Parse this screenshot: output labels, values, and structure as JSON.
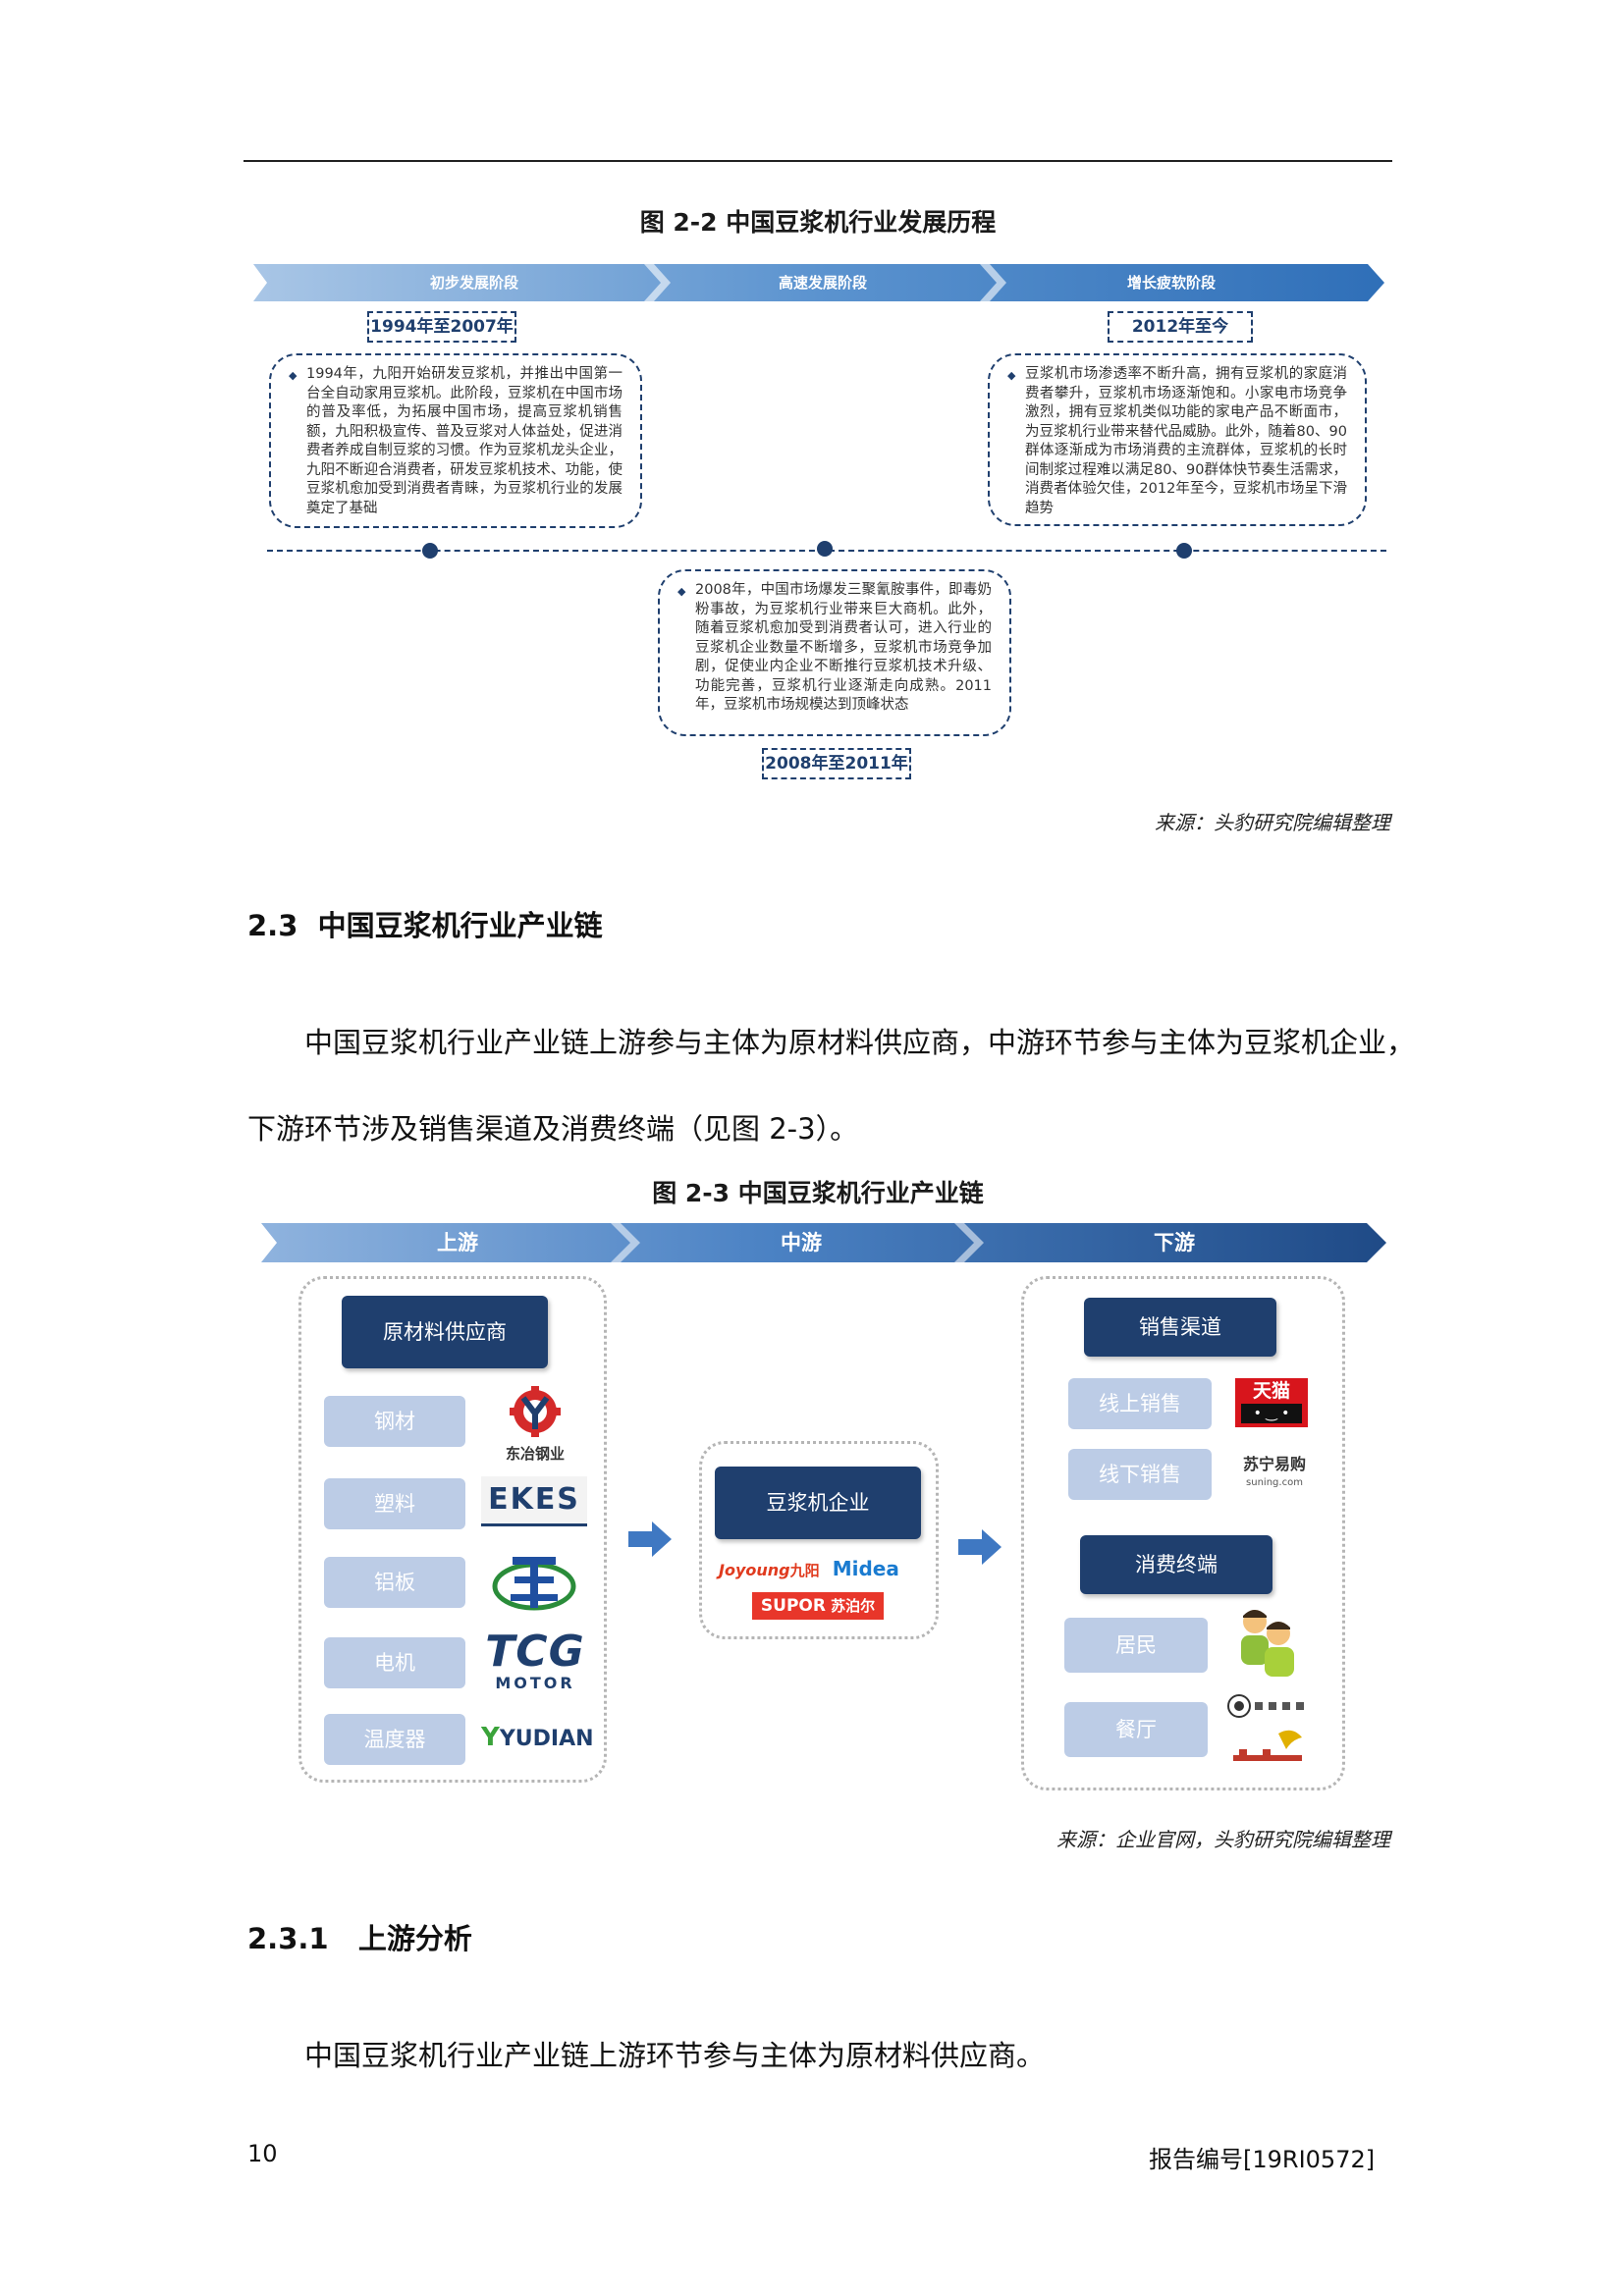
{
  "figure22": {
    "title": "图 2-2 中国豆浆机行业发展历程",
    "phases": [
      "初步发展阶段",
      "高速发展阶段",
      "增长疲软阶段"
    ],
    "periods": [
      "1994年至2007年",
      "2008年至2011年",
      "2012年至今"
    ],
    "texts": [
      "1994年，九阳开始研发豆浆机，并推出中国第一台全自动家用豆浆机。此阶段，豆浆机在中国市场的普及率低，为拓展中国市场，提高豆浆机销售额，九阳积极宣传、普及豆浆对人体益处，促进消费者养成自制豆浆的习惯。作为豆浆机龙头企业，九阳不断迎合消费者，研发豆浆机技术、功能，使豆浆机愈加受到消费者青睐，为豆浆机行业的发展奠定了基础",
      "2008年，中国市场爆发三聚氰胺事件，即毒奶粉事故，为豆浆机行业带来巨大商机。此外，随着豆浆机愈加受到消费者认可，进入行业的豆浆机企业数量不断增多，豆浆机市场竞争加剧，促使业内企业不断推行豆浆机技术升级、功能完善，豆浆机行业逐渐走向成熟。2011年，豆浆机市场规模达到顶峰状态",
      "豆浆机市场渗透率不断升高，拥有豆浆机的家庭消费者攀升，豆浆机市场逐渐饱和。小家电市场竞争激烈，拥有豆浆机类似功能的家电产品不断面市，为豆浆机行业带来替代品威胁。此外，随着80、90群体逐渐成为市场消费的主流群体，豆浆机的长时间制浆过程难以满足80、90群体快节奏生活需求，消费者体验欠佳，2012年至今，豆浆机市场呈下滑趋势"
    ],
    "source": "来源：头豹研究院编辑整理"
  },
  "section23": {
    "heading_num": "2.3",
    "heading_text": "中国豆浆机行业产业链",
    "para_line1": "中国豆浆机行业产业链上游参与主体为原材料供应商，中游环节参与主体为豆浆机企业，",
    "para_line2": "下游环节涉及销售渠道及消费终端（见图 2-3）。"
  },
  "figure23": {
    "title": "图 2-3 中国豆浆机行业产业链",
    "stages": [
      "上游",
      "中游",
      "下游"
    ],
    "upstream": {
      "header": "原材料供应商",
      "items": [
        "钢材",
        "塑料",
        "铝板",
        "电机",
        "温度器"
      ],
      "logos": [
        "东冶钢业",
        "EKES",
        "TCG",
        "MOTOR",
        "YUDIAN"
      ]
    },
    "midstream": {
      "header": "豆浆机企业",
      "logos": [
        "Joyoung",
        "九阳",
        "Midea",
        "SUPOR",
        "苏泊尔"
      ]
    },
    "downstream": {
      "channel_header": "销售渠道",
      "channels": [
        "线上销售",
        "线下销售"
      ],
      "channel_logos": [
        "天猫",
        "苏宁易购",
        "suning.com"
      ],
      "terminal_header": "消费终端",
      "terminals": [
        "居民",
        "餐厅"
      ]
    },
    "source": "来源：企业官网，头豹研究院编辑整理"
  },
  "section231": {
    "heading_num": "2.3.1",
    "heading_text": "上游分析",
    "para": "中国豆浆机行业产业链上游环节参与主体为原材料供应商。"
  },
  "footer": {
    "page_number": "10",
    "report_id": "报告编号[19RI0572]"
  },
  "colors": {
    "navy": "#1f3f6e",
    "light_blue": "#9dbde0",
    "mid_blue": "#4f86c6",
    "box_light": "#bccce6"
  }
}
